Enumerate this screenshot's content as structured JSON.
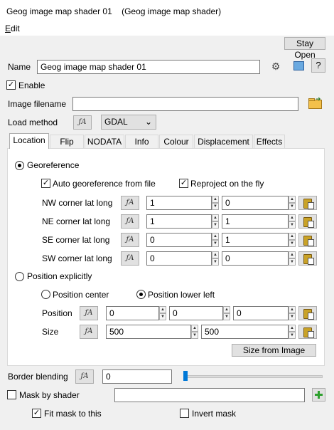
{
  "window": {
    "title": "Geog image map shader 01    (Geog image map shader)",
    "close_glyph": "×"
  },
  "menu": {
    "edit": "Edit"
  },
  "toolbar": {
    "stay_open": "Stay Open"
  },
  "name": {
    "label": "Name",
    "value": "Geog image map shader 01"
  },
  "enable": {
    "label": "Enable",
    "checked": true
  },
  "image_filename": {
    "label": "Image filename",
    "value": ""
  },
  "load_method": {
    "label": "Load method",
    "value": "GDAL"
  },
  "tabs": [
    {
      "label": "Location",
      "active": true
    },
    {
      "label": "Flip"
    },
    {
      "label": "NODATA"
    },
    {
      "label": "Info"
    },
    {
      "label": "Colour"
    },
    {
      "label": "Displacement"
    },
    {
      "label": "Effects"
    }
  ],
  "location": {
    "georeference": {
      "label": "Georeference",
      "selected": true
    },
    "auto_georeference": {
      "label": "Auto georeference from file",
      "checked": true
    },
    "reproject": {
      "label": "Reproject on the fly",
      "checked": true
    },
    "corners": [
      {
        "label": "NW corner lat long",
        "lat": "1",
        "long": "0"
      },
      {
        "label": "NE corner lat long",
        "lat": "1",
        "long": "1"
      },
      {
        "label": "SE corner lat long",
        "lat": "0",
        "long": "1"
      },
      {
        "label": "SW corner lat long",
        "lat": "0",
        "long": "0"
      }
    ],
    "position_explicitly": {
      "label": "Position explicitly",
      "selected": false
    },
    "position_center": {
      "label": "Position center",
      "selected": false
    },
    "position_lower_left": {
      "label": "Position lower left",
      "selected": true
    },
    "position": {
      "label": "Position",
      "x": "0",
      "y": "0",
      "z": "0"
    },
    "size": {
      "label": "Size",
      "w": "500",
      "h": "500"
    },
    "size_from_image": "Size from Image"
  },
  "border_blending": {
    "label": "Border blending",
    "value": "0",
    "slider_fraction": 0.0
  },
  "mask_by_shader": {
    "label": "Mask by shader",
    "checked": false,
    "value": ""
  },
  "fit_mask": {
    "label": "Fit mask to this",
    "checked": true
  },
  "invert_mask": {
    "label": "Invert mask",
    "checked": false
  },
  "icons": {
    "gear": "gear-icon",
    "preview": "preview-icon",
    "help": "?",
    "folder": "folder-open-icon",
    "add": "add-shader-icon",
    "fx": "ƒA",
    "spin_up": "▲",
    "spin_down": "▼",
    "check": "✓",
    "dropdown": "⌄"
  }
}
